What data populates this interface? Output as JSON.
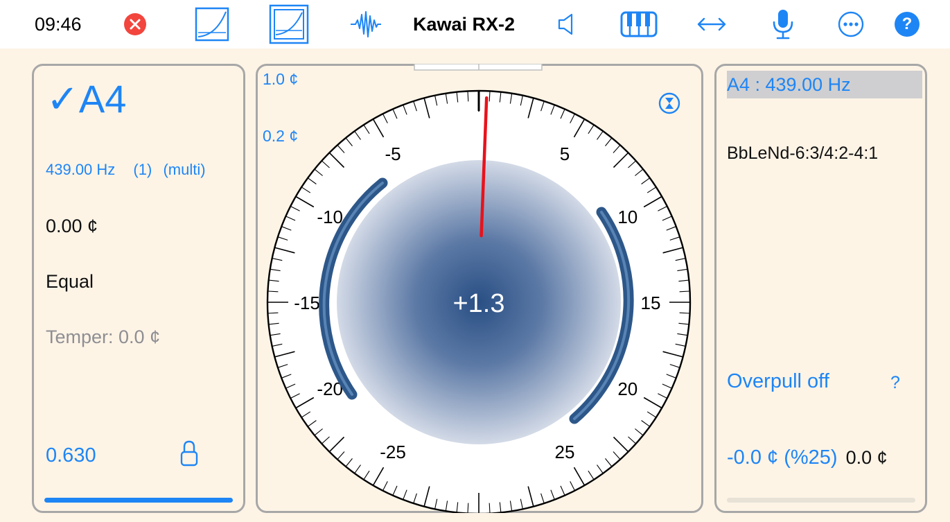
{
  "topbar": {
    "time": "09:46",
    "device_name": "Kawai RX-2",
    "icons": {
      "close": "close-circle-icon",
      "curve1": "tuning-curve-icon",
      "curve2": "tuning-curve-boxed-icon",
      "waveform": "waveform-icon",
      "speaker": "speaker-icon",
      "piano": "piano-keys-icon",
      "stretch": "left-right-arrows-icon",
      "mic": "microphone-icon",
      "more": "more-options-icon",
      "help": "help-icon"
    },
    "help_glyph": "?"
  },
  "left_panel": {
    "check": "✓",
    "note": "A4",
    "frequency": "439.00 Hz",
    "count": "(1)",
    "mode": "(multi)",
    "offset": "0.00 ¢",
    "temperament": "Equal",
    "temper": "Temper: 0.0 ¢",
    "value": "0.630",
    "progress": 1.0
  },
  "dial": {
    "scale_top": "1.0 ¢",
    "scale_sub": "0.2 ¢",
    "reading": "+1.3",
    "needle_cents": 1.3,
    "range_cents": 30,
    "label_values": [
      -25,
      -20,
      -15,
      -10,
      -5,
      5,
      10,
      15,
      20,
      25
    ],
    "labels": [
      "-25",
      "-20",
      "-15",
      "-10",
      "-5",
      "5",
      "10",
      "15",
      "20",
      "25"
    ]
  },
  "right_panel": {
    "header": "A4 : 439.00 Hz",
    "code": "BbLeNd-6:3/4:2-4:1",
    "overpull": "Overpull off",
    "help": "?",
    "offset_blue": "-0.0 ¢ (%25)",
    "offset_gray": "0.0 ¢",
    "progress": 0
  },
  "colors": {
    "accent": "#1e85f5",
    "needle": "#e8121b",
    "arc": "#3a6496",
    "close": "#f2453d",
    "background": "#fdf4e6"
  }
}
